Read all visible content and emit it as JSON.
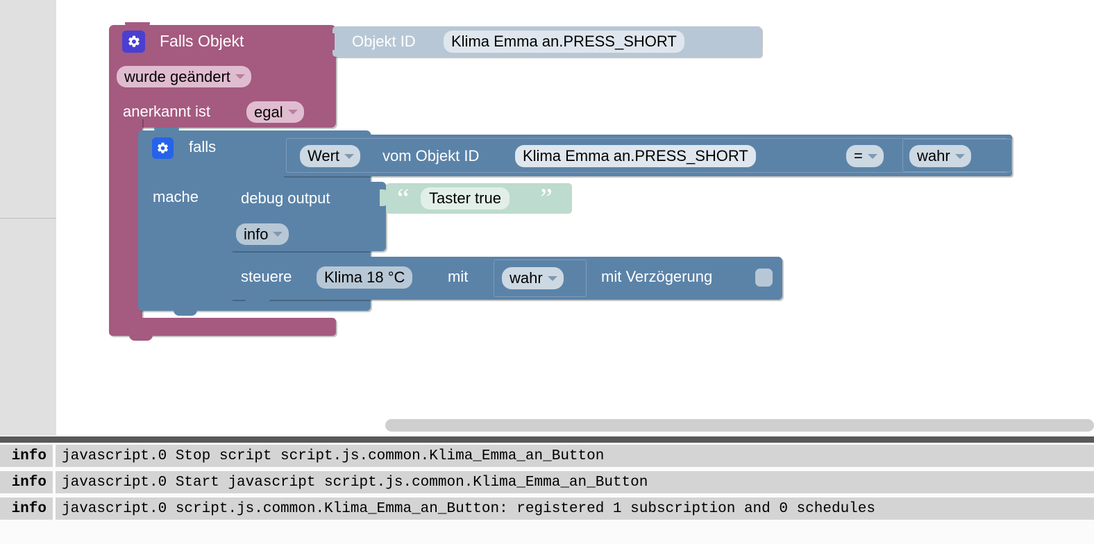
{
  "workspace": {
    "blocks": {
      "trigger": {
        "title": "Falls Objekt",
        "gear_icon": "gear-icon",
        "mode_dropdown": "wurde geändert",
        "ack_label": "anerkannt ist",
        "ack_dropdown": "egal",
        "object_id_block": {
          "label": "Objekt ID",
          "value": "Klima Emma an.PRESS_SHORT"
        }
      },
      "if_block": {
        "gear_icon": "gear-icon",
        "if_label": "falls",
        "do_label": "mache",
        "condition": {
          "attribute_dropdown": "Wert",
          "middle_label": "vom Objekt ID",
          "object_id": "Klima Emma an.PRESS_SHORT",
          "operator_dropdown": "=",
          "compare_dropdown": "wahr"
        }
      },
      "debug_block": {
        "label": "debug output",
        "level_dropdown": "info",
        "text_value": "Taster true",
        "quote_open": "“",
        "quote_close": "”"
      },
      "control_block": {
        "label": "steuere",
        "target_value": "Klima 18 °C",
        "with_label": "mit",
        "value_dropdown": "wahr",
        "delay_label": "mit Verzögerung",
        "delay_checkbox_checked": false
      }
    },
    "colors": {
      "trigger_block": "#a55a80",
      "logic_block": "#5b83a8",
      "object_id_block": "#b7c7d5",
      "text_block": "#bddbce",
      "gear_trigger": "#4b3fd0",
      "gear_logic": "#2563eb"
    }
  },
  "scrollbar": {
    "horizontal_name": "horizontal-scrollbar"
  },
  "log": {
    "rows": [
      {
        "severity": "info",
        "message": "javascript.0 Stop script script.js.common.Klima_Emma_an_Button"
      },
      {
        "severity": "info",
        "message": "javascript.0 Start javascript script.js.common.Klima_Emma_an_Button"
      },
      {
        "severity": "info",
        "message": "javascript.0 script.js.common.Klima_Emma_an_Button: registered 1 subscription and 0 schedules"
      }
    ]
  }
}
